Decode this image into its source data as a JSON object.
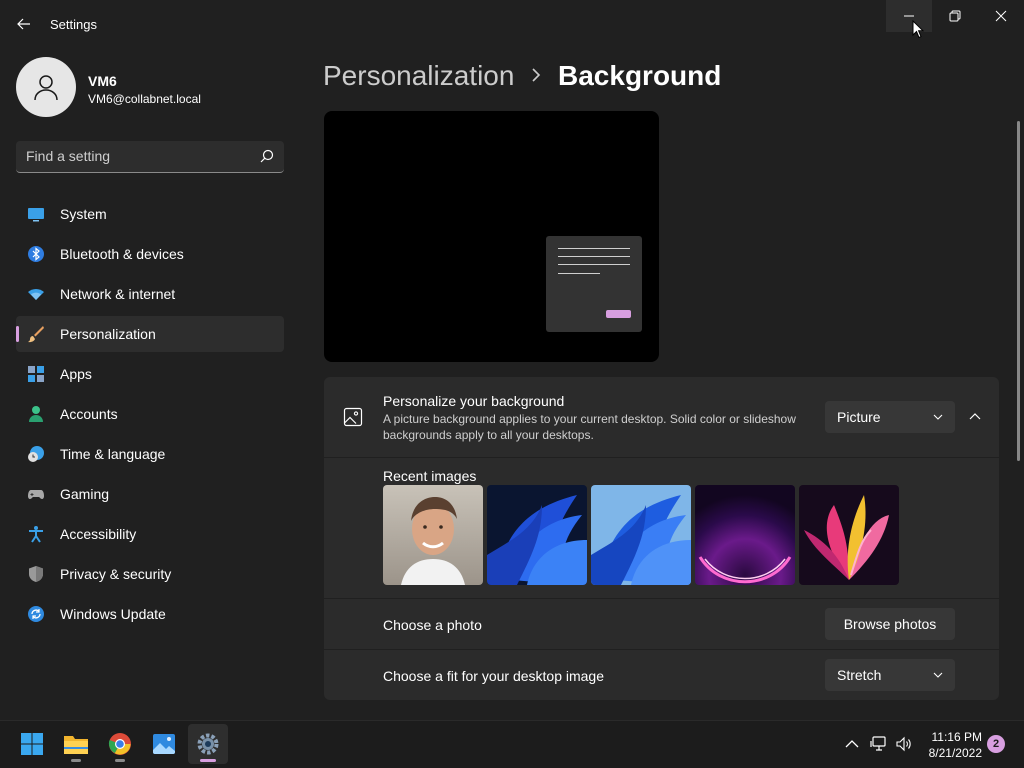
{
  "app": {
    "title": "Settings"
  },
  "user": {
    "name": "VM6",
    "email": "VM6@collabnet.local"
  },
  "search": {
    "placeholder": "Find a setting"
  },
  "nav": {
    "items": [
      {
        "label": "System",
        "icon": "monitor-icon"
      },
      {
        "label": "Bluetooth & devices",
        "icon": "bluetooth-icon"
      },
      {
        "label": "Network & internet",
        "icon": "wifi-icon"
      },
      {
        "label": "Personalization",
        "icon": "paintbrush-icon",
        "selected": true
      },
      {
        "label": "Apps",
        "icon": "apps-icon"
      },
      {
        "label": "Accounts",
        "icon": "person-icon"
      },
      {
        "label": "Time & language",
        "icon": "clock-globe-icon"
      },
      {
        "label": "Gaming",
        "icon": "gamepad-icon"
      },
      {
        "label": "Accessibility",
        "icon": "accessibility-icon"
      },
      {
        "label": "Privacy & security",
        "icon": "shield-icon"
      },
      {
        "label": "Windows Update",
        "icon": "update-icon"
      }
    ]
  },
  "breadcrumb": {
    "parent": "Personalization",
    "current": "Background"
  },
  "personalize": {
    "title": "Personalize your background",
    "description": "A picture background applies to your current desktop. Solid color or slideshow backgrounds apply to all your desktops.",
    "selected": "Picture"
  },
  "recent": {
    "label": "Recent images"
  },
  "photo": {
    "label": "Choose a photo",
    "button": "Browse photos"
  },
  "fit": {
    "label": "Choose a fit for your desktop image",
    "selected": "Stretch"
  },
  "taskbar": {
    "apps": [
      "start-icon",
      "file-explorer-icon",
      "chrome-icon",
      "photos-icon",
      "settings-icon"
    ],
    "time": "11:16 PM",
    "date": "8/21/2022",
    "notifications": "2"
  },
  "colors": {
    "accent": "#d89fe0",
    "background": "#202020",
    "card": "#2b2b2b"
  }
}
